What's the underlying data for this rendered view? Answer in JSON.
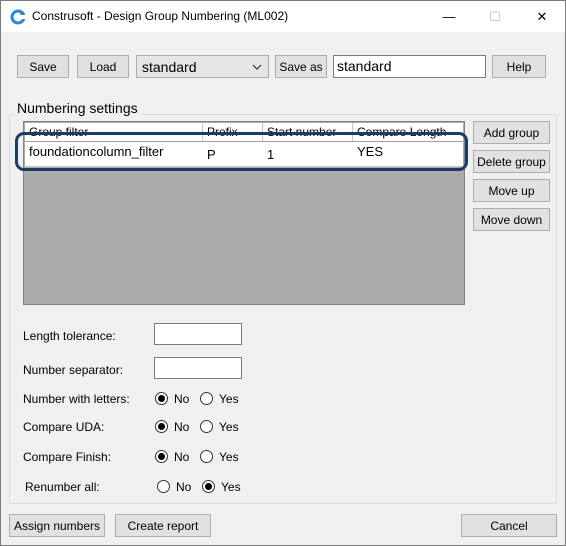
{
  "window": {
    "title": "Construsoft - Design Group Numbering (ML002)",
    "min_glyph": "—",
    "max_glyph": "☐",
    "close_glyph": "✕"
  },
  "toolbar": {
    "save_label": "Save",
    "load_label": "Load",
    "preset_value": "standard",
    "save_as_label": "Save as",
    "save_as_value": "standard",
    "help_label": "Help"
  },
  "numbering": {
    "title": "Numbering settings",
    "columns": [
      "Group filter",
      "Prefix",
      "Start number",
      "Compare Length"
    ],
    "rows": [
      [
        "foundationcolumn_filter",
        "P",
        "1",
        "YES"
      ]
    ]
  },
  "side_buttons": {
    "add_group": "Add group",
    "delete_group": "Delete group",
    "move_up": "Move up",
    "move_down": "Move down"
  },
  "fields": {
    "length_tolerance_label": "Length tolerance:",
    "length_tolerance_value": "",
    "number_separator_label": "Number separator:",
    "number_separator_value": ""
  },
  "options": [
    {
      "label": "Number with letters:",
      "selected": "No"
    },
    {
      "label": "Compare UDA:",
      "selected": "No"
    },
    {
      "label": "Compare Finish:",
      "selected": "No"
    },
    {
      "label": "Renumber all:",
      "selected": "Yes"
    }
  ],
  "option_no_label": "No",
  "option_yes_label": "Yes",
  "footer": {
    "assign_label": "Assign numbers",
    "report_label": "Create report",
    "cancel_label": "Cancel"
  },
  "colors": {
    "highlight": "#1c3b66",
    "icon_blue": "#2e86d6"
  }
}
